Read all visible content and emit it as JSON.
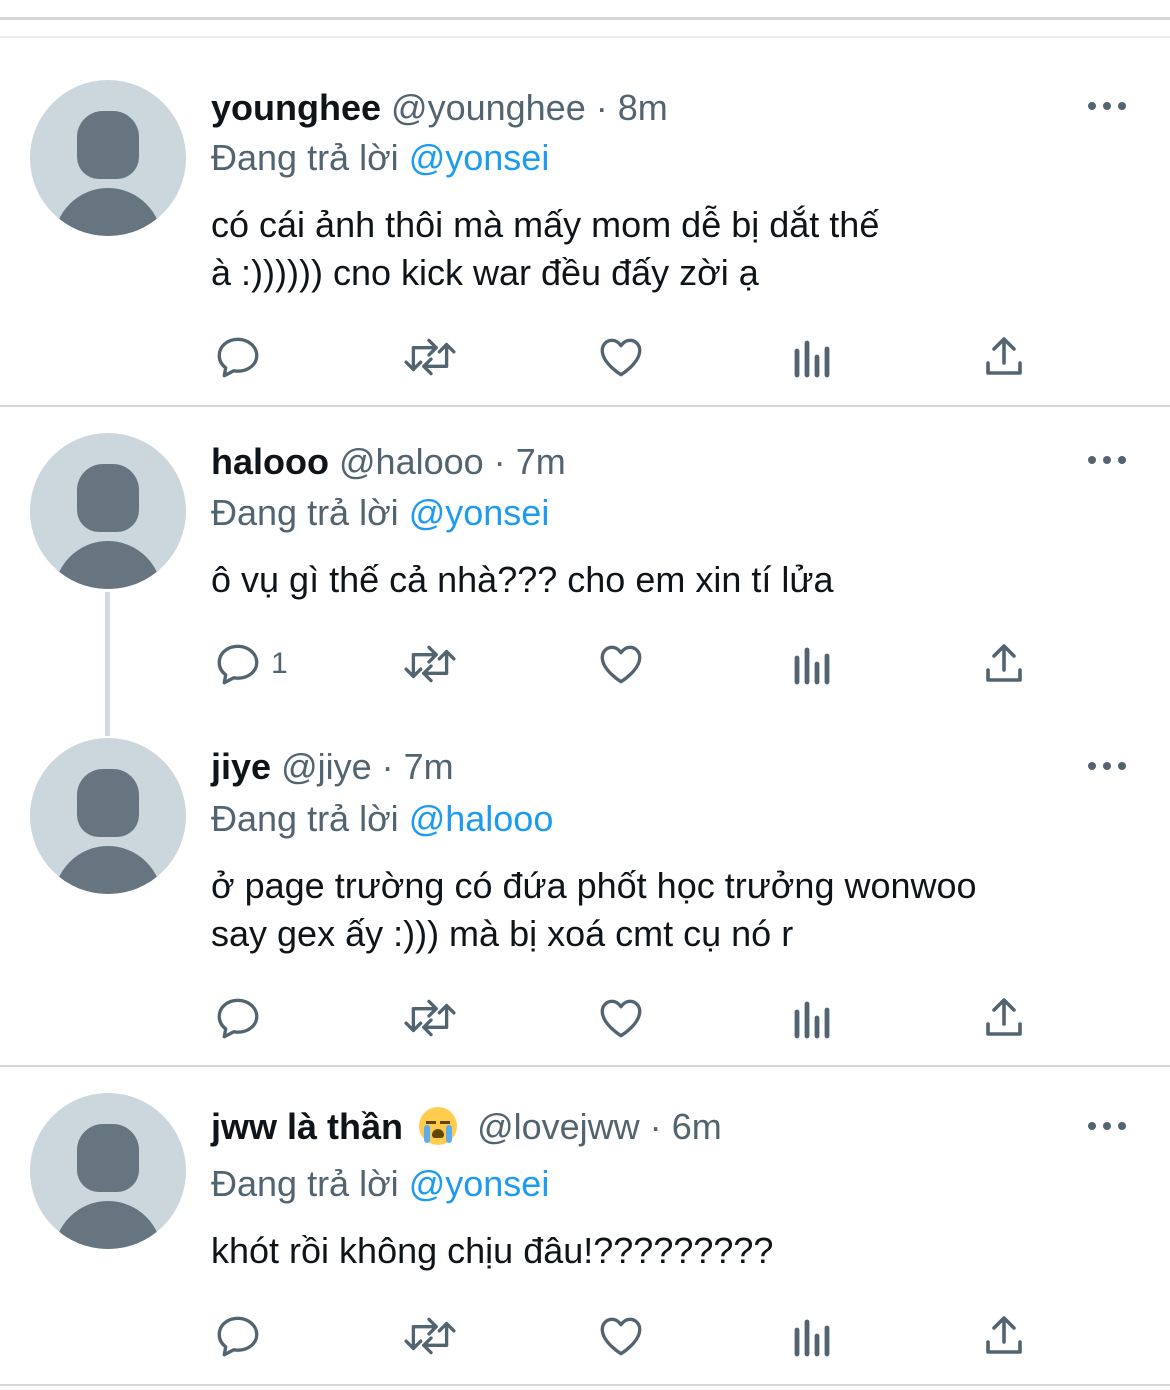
{
  "reply_prefix": "Đang trả lời",
  "tweets": [
    {
      "name": "younghee",
      "handle": "@younghee",
      "separator": "·",
      "time": "8m",
      "reply_to": "@yonsei",
      "text": "có cái ảnh thôi mà mấy mom dễ bị dắt thế\nà :)))))) cno kick war đều đấy zời ạ",
      "reply_count": ""
    },
    {
      "name": "halooo",
      "handle": "@halooo",
      "separator": "·",
      "time": "7m",
      "reply_to": "@yonsei",
      "text": "ô vụ gì thế cả nhà??? cho em xin tí lửa",
      "reply_count": "1"
    },
    {
      "name": "jiye",
      "handle": "@jiye",
      "separator": "·",
      "time": "7m",
      "reply_to": "@halooo",
      "text": "ở page trường có đứa phốt học trưởng wonwoo\nsay gex ấy :))) mà bị xoá cmt cụ nó r",
      "reply_count": ""
    },
    {
      "name": "jww là thần",
      "name_emoji": "loudly-crying-face-emoji",
      "handle": "@lovejww",
      "separator": "·",
      "time": "6m",
      "reply_to": "@yonsei",
      "text": "khót rồi không chịu đâu!?????????",
      "reply_count": ""
    }
  ],
  "colors": {
    "text_primary": "#0f1419",
    "text_secondary": "#536471",
    "mention": "#1d9bf0",
    "avatar_bg": "#ccd6dd",
    "avatar_fg": "#66757f",
    "divider": "#d4d7db"
  },
  "icons": [
    "reply-icon",
    "retweet-icon",
    "like-icon",
    "analytics-icon",
    "share-icon",
    "more-options-icon",
    "default-avatar-icon"
  ]
}
